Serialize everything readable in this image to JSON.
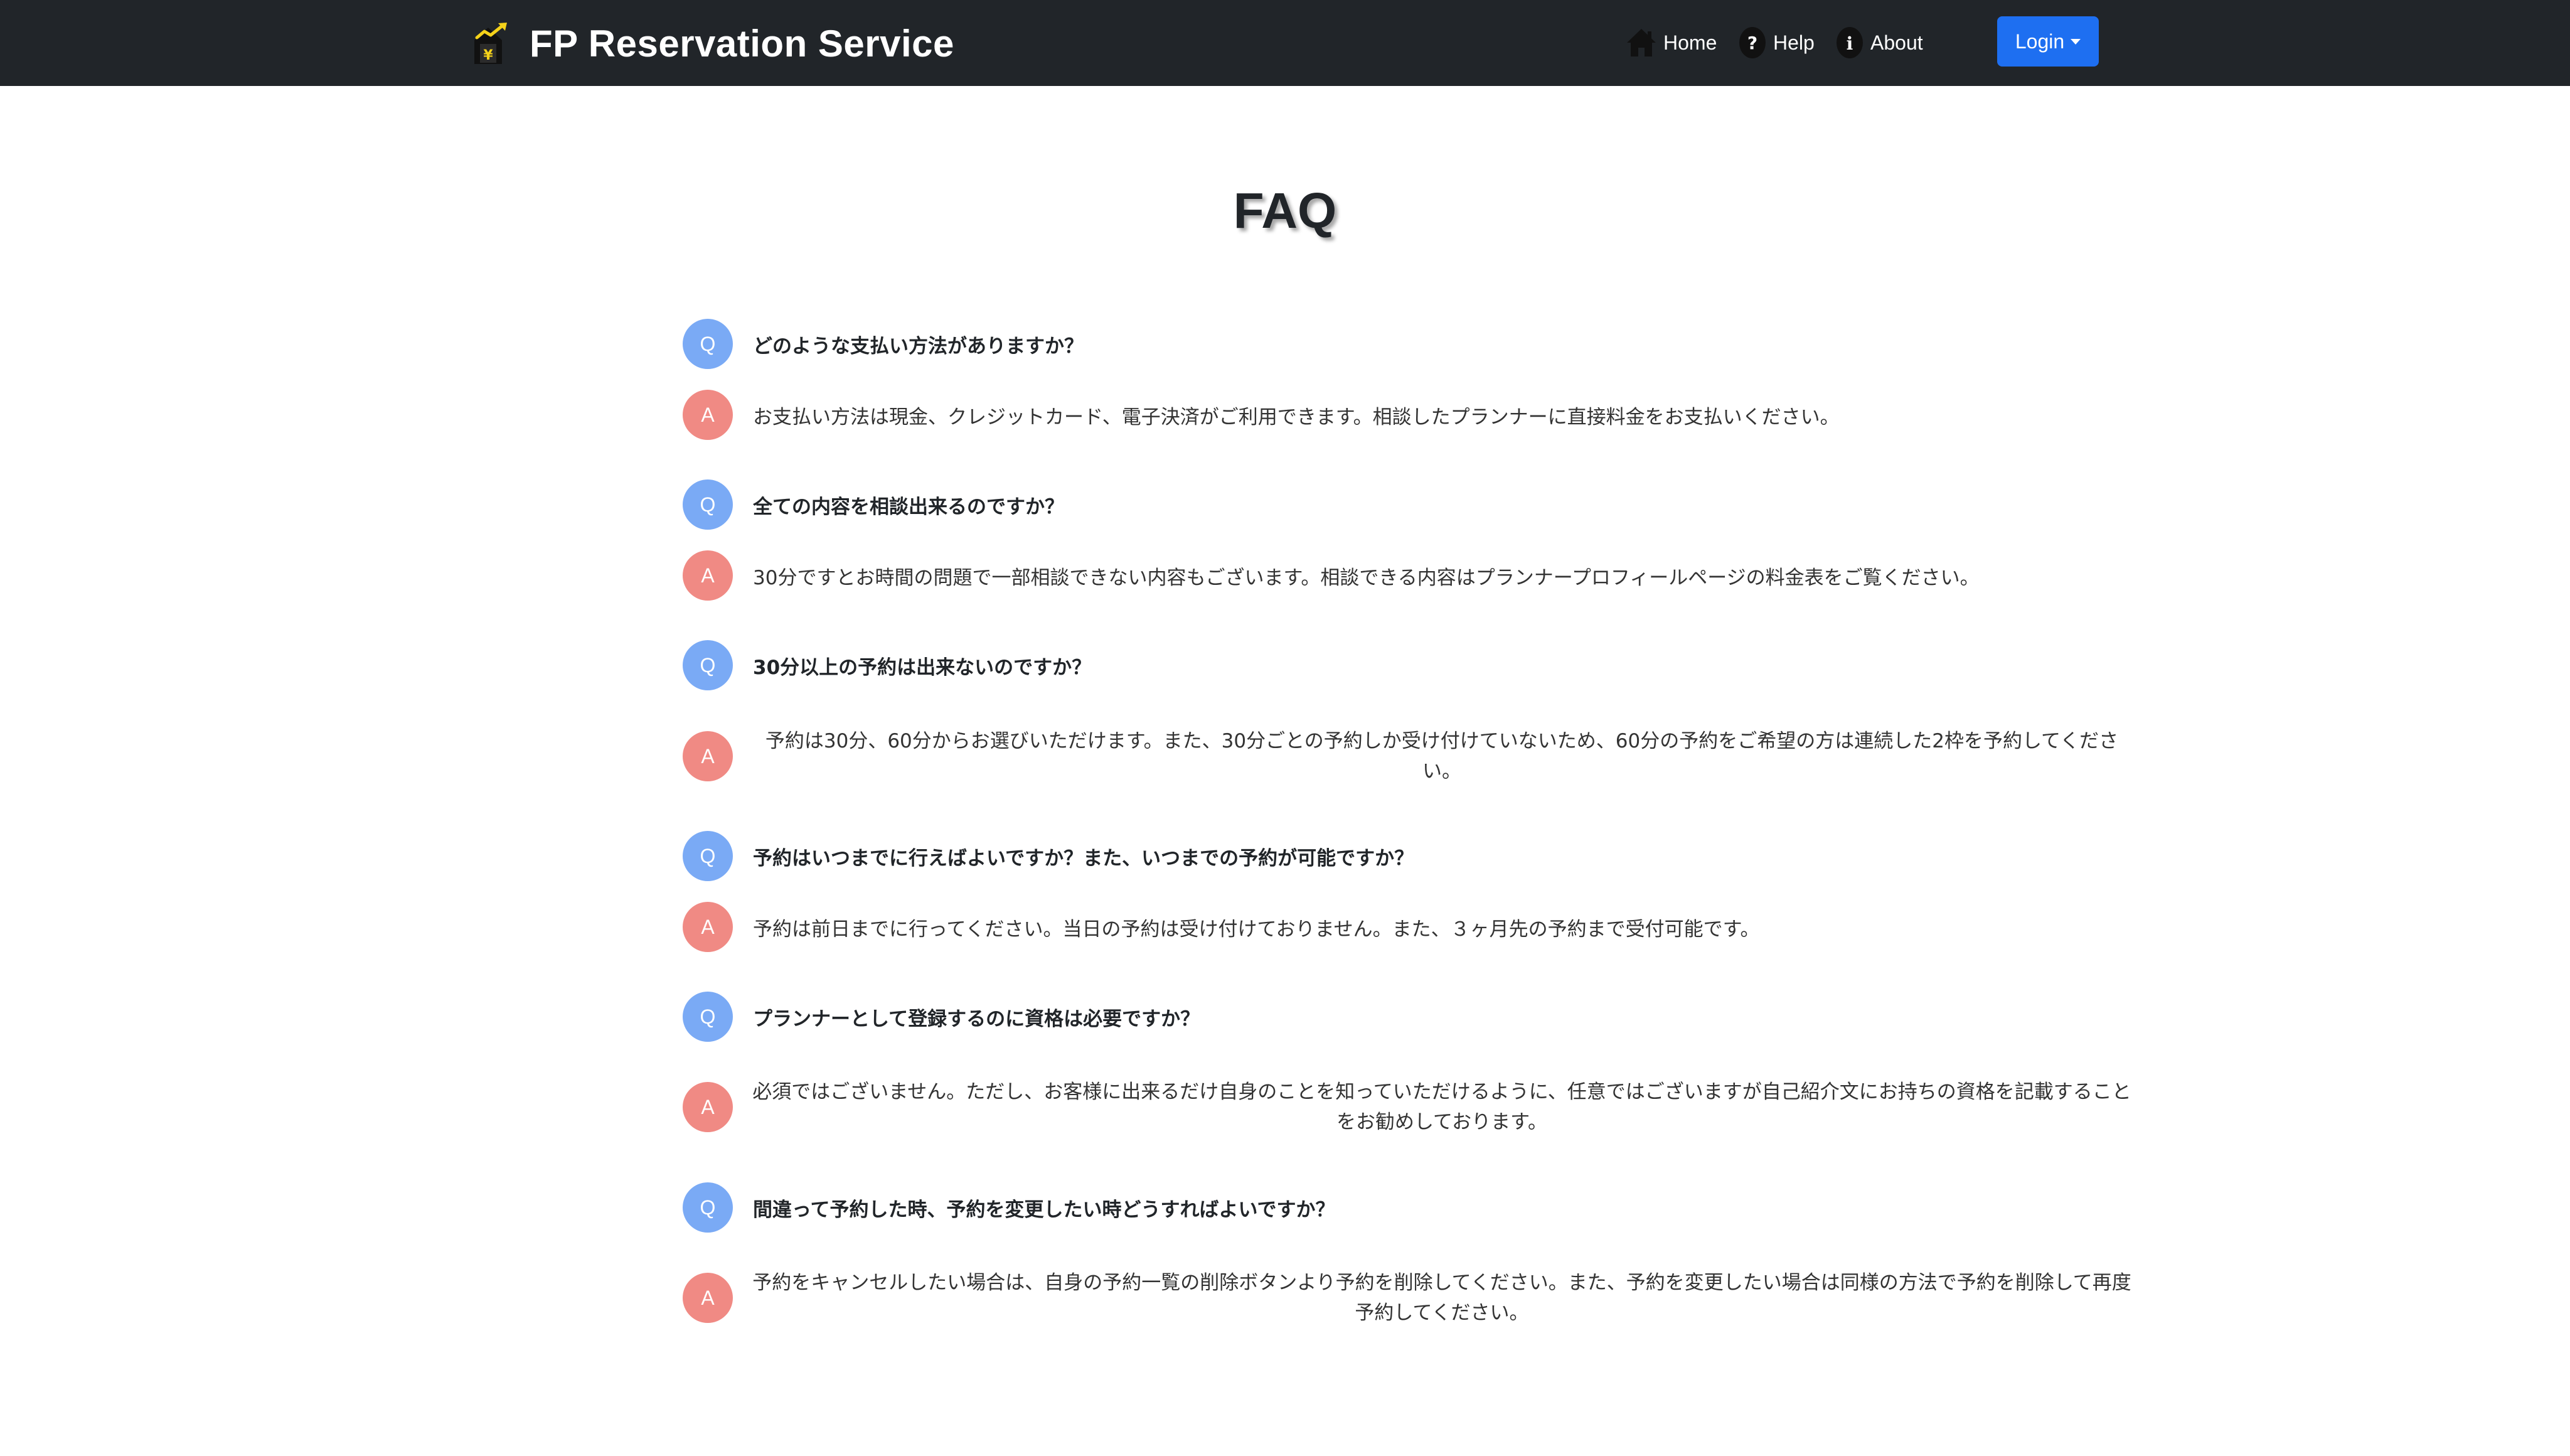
{
  "header": {
    "brand": "FP Reservation Service",
    "logo_icon": "house-yen-growth-icon",
    "nav": {
      "home": "Home",
      "help": "Help",
      "about": "About"
    },
    "login_label": "Login"
  },
  "colors": {
    "navbar": "#212529",
    "login_button": "#1e6ff1",
    "question_badge": "#7aaaf5",
    "answer_badge": "#f08a84",
    "logo_yellow": "#f5d21a"
  },
  "main": {
    "title": "FAQ",
    "q_badge": "Q",
    "a_badge": "A",
    "faqs": [
      {
        "question": "どのような支払い方法がありますか？",
        "answer": "お支払い方法は現金、クレジットカード、電子決済がご利用できます。相談したプランナーに直接料金をお支払いください。"
      },
      {
        "question": "全ての内容を相談出来るのですか？",
        "answer": "30分ですとお時間の問題で一部相談できない内容もございます。相談できる内容はプランナープロフィールページの料金表をご覧ください。"
      },
      {
        "question": "30分以上の予約は出来ないのですか？",
        "answer": "予約は30分、60分からお選びいただけます。また、30分ごとの予約しか受け付けていないため、60分の予約をご希望の方は連続した2枠を予約してください。"
      },
      {
        "question": "予約はいつまでに行えばよいですか？また、いつまでの予約が可能ですか？",
        "answer": "予約は前日までに行ってください。当日の予約は受け付けておりません。また、３ヶ月先の予約まで受付可能です。"
      },
      {
        "question": "プランナーとして登録するのに資格は必要ですか？",
        "answer": "必須ではございません。ただし、お客様に出来るだけ自身のことを知っていただけるように、任意ではございますが自己紹介文にお持ちの資格を記載することをお勧めしております。"
      },
      {
        "question": "間違って予約した時、予約を変更したい時どうすればよいですか？",
        "answer": "予約をキャンセルしたい場合は、自身の予約一覧の削除ボタンより予約を削除してください。また、予約を変更したい場合は同様の方法で予約を削除して再度予約してください。"
      }
    ]
  }
}
